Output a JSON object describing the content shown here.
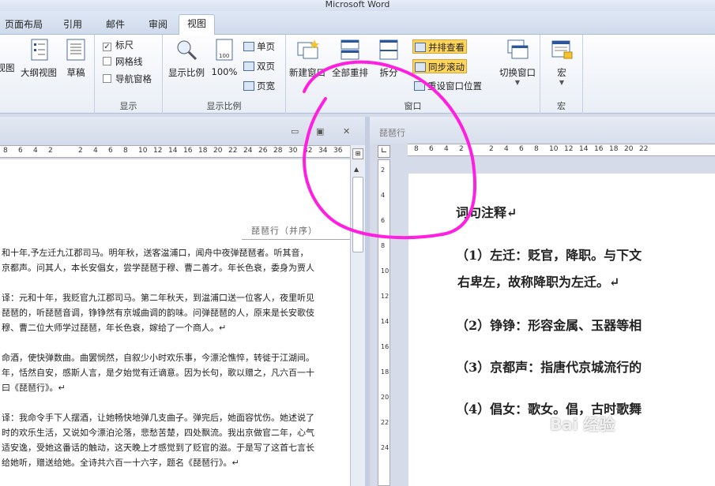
{
  "app": {
    "title": "Microsoft Word"
  },
  "tabs": [
    {
      "label": "页面布局"
    },
    {
      "label": "引用"
    },
    {
      "label": "邮件"
    },
    {
      "label": "审阅"
    },
    {
      "label": "视图"
    }
  ],
  "ribbon": {
    "views": {
      "web_label": "视图",
      "outline": "大纲视图",
      "draft": "草稿"
    },
    "show": {
      "ruler": "标尺",
      "gridlines": "网格线",
      "nav": "导航窗格",
      "group": "显示"
    },
    "zoom": {
      "zoom": "显示比例",
      "hundred": "100%",
      "one_page": "单页",
      "two_page": "双页",
      "page_width": "页宽",
      "group": "显示比例"
    },
    "window": {
      "new_window": "新建窗口",
      "arrange_all": "全部重排",
      "split": "拆分",
      "side_by_side": "并排查看",
      "sync_scroll": "同步滚动",
      "reset_position": "重设窗口位置",
      "switch": "切换窗口",
      "group": "窗口"
    },
    "macros": {
      "macro": "宏",
      "group": "宏"
    }
  },
  "left_pane": {
    "ruler_ticks": [
      "8",
      "6",
      "4",
      "2",
      "",
      "2",
      "4",
      "6",
      "8",
      "10",
      "12",
      "14",
      "16",
      "18",
      "20",
      "22",
      "24",
      "26",
      "28",
      "30",
      "32",
      "34",
      "36"
    ],
    "title_line": "琵琶行（并序）",
    "lines": [
      "和十年,予左迁九江郡司马。明年秋，送客湓浦口，闻舟中夜弹琵琶者。听其音，",
      "京都声。问其人，本长安倡女，尝学琵琶于穆、曹二善才。年长色衰，委身为贾人",
      "",
      "译：元和十年，我贬官九江郡司马。第二年秋天，到湓浦口送一位客人，夜里听见",
      "琵琶的，听琵琶音调，铮铮然有京城曲调的韵味。问弹琵琶的人，原来是长安歌伎",
      "穆、曹二位大师学过琵琶，年长色衰，嫁给了一个商人。↵",
      "",
      "命酒，使快弹数曲。曲罢悯然，自叙少小时欢乐事，今漂沦憔悴，转徙于江湖间。",
      "年，恬然自安，感斯人言，是夕始觉有迁谪意。因为长句，歌以赠之，凡六百一十",
      "曰《琵琶行》。↵",
      "",
      "译：我命令手下人摆酒，让她畅快地弹几支曲子。弹完后，她面容忧伤。她述说了",
      "时的欢乐生活，又说如今漂泊沦落，悲愁苦楚，四处飘流。我出京做官二年，心气",
      "适安逸，受她这番话的触动，这天晚上才感觉到了贬官的滋。于是写了这首七言长",
      "给她听，赠送给她。全诗共六百一十六字，题名《琵琶行》。↵"
    ]
  },
  "right_pane": {
    "doc_title": "琵琶行",
    "ruler_ticks": [
      "8",
      "6",
      "4",
      "2",
      "",
      "2",
      "4",
      "6",
      "8",
      "10",
      "12",
      "14",
      "16",
      "18",
      "20",
      "22"
    ],
    "vruler_ticks": [
      "2",
      "4",
      "6",
      "8",
      "10",
      "12",
      "14",
      "16",
      "18",
      "20",
      "22",
      "24"
    ],
    "lines": [
      "词句注释↵",
      "（1）左迁：贬官，降职。与下文",
      "右卑左，故称降职为左迁。↵",
      "（2）铮铮：形容金属、玉器等相",
      "（3）京都声：指唐代京城流行的",
      "（4）倡女：歌女。倡，古时歌舞"
    ]
  },
  "watermark": "Bai 经验",
  "colors": {
    "annotation": "#ff1fe0",
    "accent": "#2b579a"
  }
}
